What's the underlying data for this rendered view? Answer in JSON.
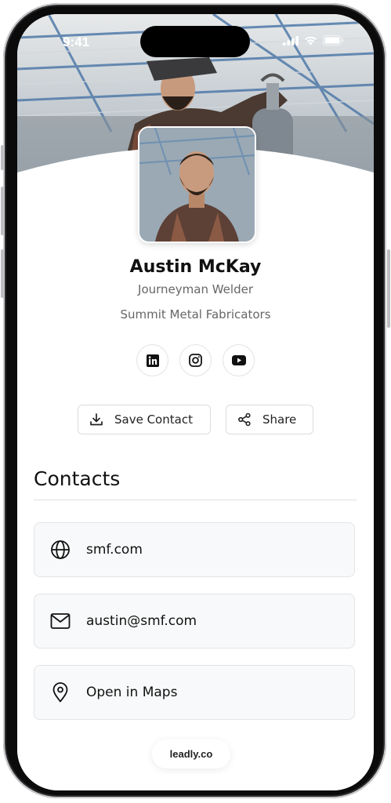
{
  "status_bar": {
    "time": "9:41"
  },
  "profile": {
    "name": "Austin McKay",
    "title": "Journeyman Welder",
    "company": "Summit Metal Fabricators"
  },
  "social_links": [
    {
      "icon": "linkedin-icon"
    },
    {
      "icon": "instagram-icon"
    },
    {
      "icon": "youtube-icon"
    }
  ],
  "actions": {
    "save_label": "Save Contact",
    "share_label": "Share"
  },
  "contacts": {
    "heading": "Contacts",
    "items": [
      {
        "icon": "globe-icon",
        "label": "smf.com"
      },
      {
        "icon": "mail-icon",
        "label": "austin@smf.com"
      },
      {
        "icon": "map-pin-icon",
        "label": "Open in Maps"
      }
    ]
  },
  "footer": {
    "brand": "leadly.co"
  }
}
